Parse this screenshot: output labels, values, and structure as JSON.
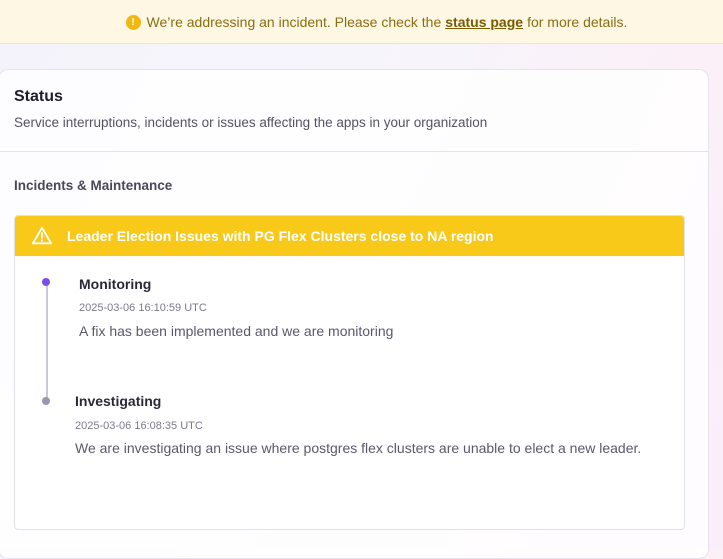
{
  "banner": {
    "icon": "info-icon",
    "text_before": "We’re addressing an incident. Please check the",
    "link_text": "status page",
    "text_after": "for more details."
  },
  "status_panel": {
    "title": "Status",
    "subtitle": "Service interruptions, incidents or issues affecting the apps in your organization"
  },
  "section": {
    "label": "Incidents & Maintenance"
  },
  "incident": {
    "title": "Leader Election Issues with PG Flex Clusters close to NA region",
    "color": "#f9c91a",
    "updates": [
      {
        "status": "Monitoring",
        "timestamp": "2025-03-06 16:10:59 UTC",
        "message": "A fix has been implemented and we are monitoring"
      },
      {
        "status": "Investigating",
        "timestamp": "2025-03-06 16:08:35 UTC",
        "message": "We are investigating an issue where postgres flex clusters are unable to elect a new leader."
      }
    ]
  },
  "colors": {
    "accent": "#7b4fe6",
    "warning": "#f9c91a",
    "banner_bg": "#fdf7e3"
  }
}
